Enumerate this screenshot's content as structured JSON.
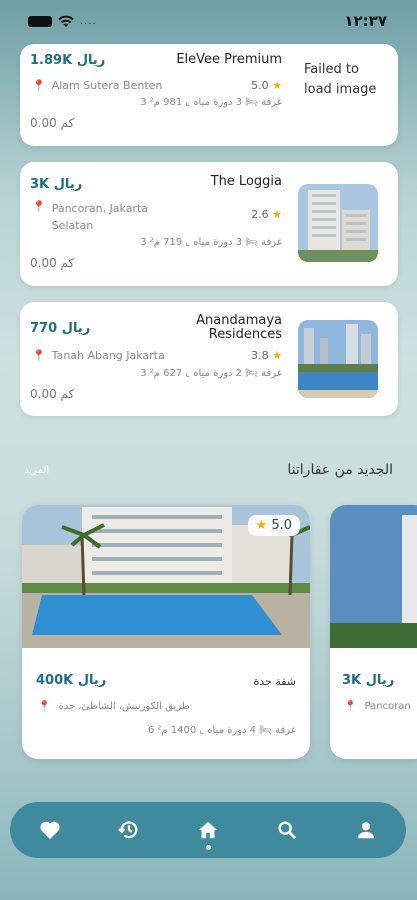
{
  "status": {
    "time": "١٢:٣٧",
    "dots": "...."
  },
  "listings": [
    {
      "price": "1.89K ريال",
      "title": "EleVee Premium",
      "location": "Alam Sutera Benten",
      "rating": "5.0",
      "specs": "3 غرفة  🛏  3 دورة مياه  ⌞  981 م²",
      "distance": "0.00 كم",
      "image_error": "Failed to load image"
    },
    {
      "price": "3K ريال",
      "title": "The Loggia",
      "location": "Pancoran, Jakarta Selatan",
      "rating": "2.6",
      "specs": "3 غرفة  🛏  3 دورة مياه  ⌞  719 م²",
      "distance": "0.00 كم"
    },
    {
      "price": "770 ريال",
      "title": "Anandamaya Residences",
      "location": "Tanah Abang Jakarta",
      "rating": "3.8",
      "specs": "3 غرفة  🛏  2 دورة مياه  ⌞  627 م²",
      "distance": "0.00 كم"
    }
  ],
  "new_section": {
    "title": "الجديد من عقاراتنا",
    "more": "المزيد"
  },
  "featured": [
    {
      "price": "400K ريال",
      "title": "شقة جدة",
      "location": "طريق الكورنيش، الشاطئ، جدة",
      "rating": "5.0",
      "specs": "6 غرفة  🛏  4 دورة مياه  ⌞  1400 م²"
    },
    {
      "price": "3K ريال",
      "location": "Pancoran"
    }
  ],
  "nav": {
    "items": [
      "favorites-icon",
      "history-icon",
      "home-icon",
      "search-icon",
      "profile-icon"
    ],
    "active": "home-icon",
    "color": "#3f8a9c"
  }
}
